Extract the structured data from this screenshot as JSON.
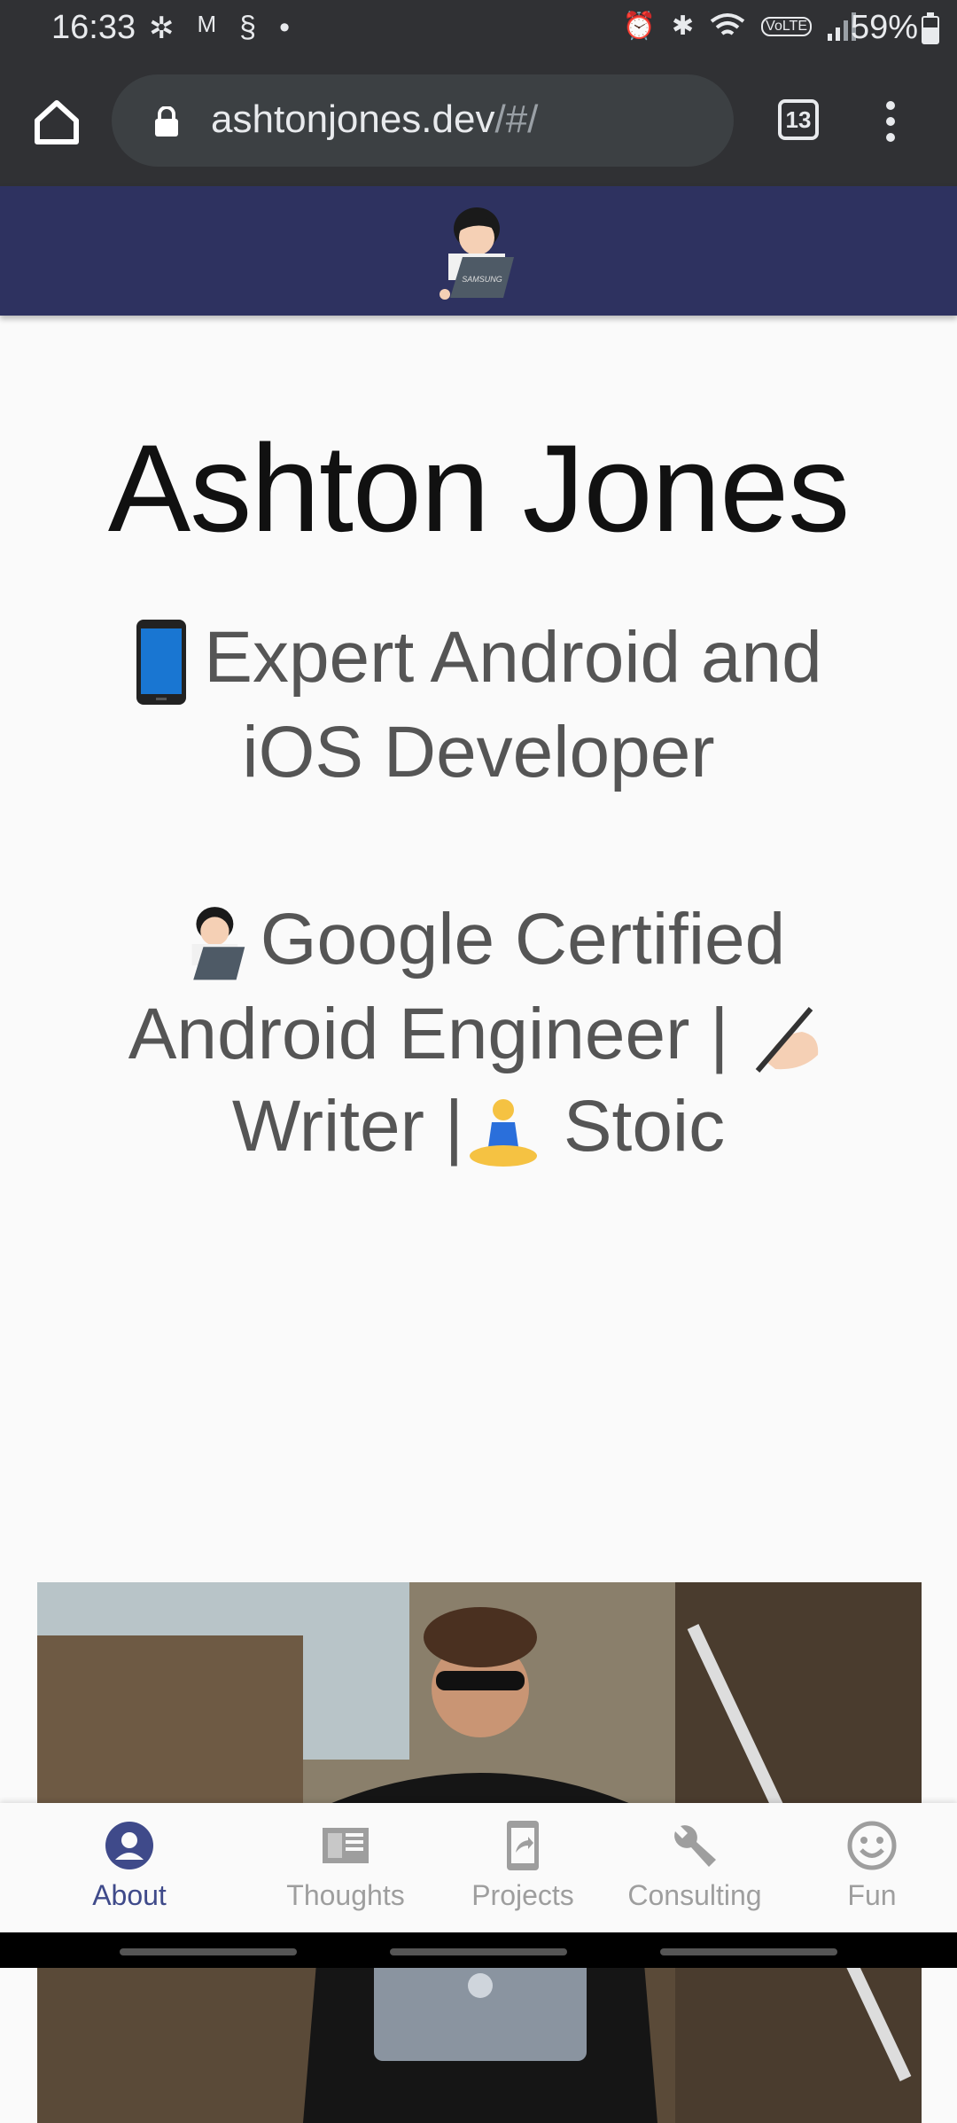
{
  "status_bar": {
    "time": "16:33",
    "battery": "59%",
    "battery_level": 0.59,
    "left_icons": [
      "pinwheel-icon",
      "gmail-icon",
      "shazam-icon",
      "dot-icon"
    ],
    "right_icons": [
      "alarm-icon",
      "bluetooth-icon",
      "wifi-icon",
      "volte-icon",
      "signal-icon"
    ]
  },
  "browser": {
    "url_host": "ashtonjones.dev",
    "url_path": "/#/",
    "tab_count": "13"
  },
  "colors": {
    "header": "#2e3260",
    "accent": "#3f4a8a"
  },
  "profile": {
    "name": "Ashton Jones",
    "tagline1": "Expert Android and iOS Developer",
    "tagline2_a": "Google Certified Android Engineer |",
    "tagline2_b": "Writer |",
    "tagline2_c": "Stoic"
  },
  "nav": {
    "items": [
      {
        "label": "About",
        "icon": "person-icon",
        "active": true
      },
      {
        "label": "Thoughts",
        "icon": "article-icon",
        "active": false
      },
      {
        "label": "Projects",
        "icon": "share-icon",
        "active": false
      },
      {
        "label": "Consulting",
        "icon": "wrench-icon",
        "active": false
      },
      {
        "label": "Fun",
        "icon": "smiley-icon",
        "active": false
      }
    ]
  }
}
